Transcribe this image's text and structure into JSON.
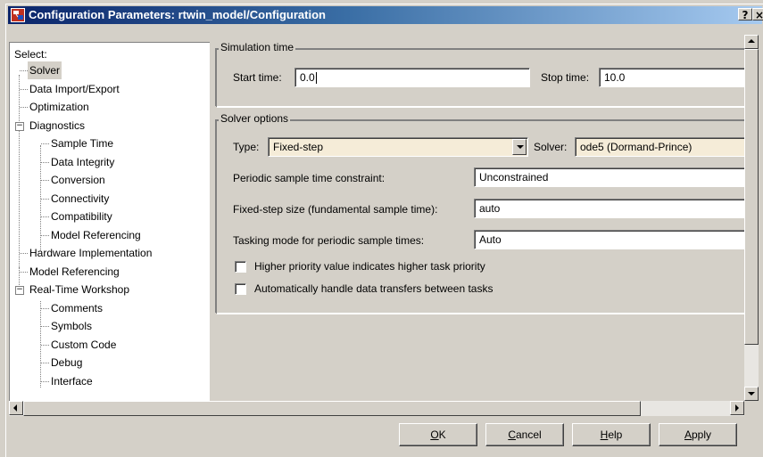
{
  "window": {
    "title": "Configuration Parameters: rtwin_model/Configuration",
    "help_button": "?",
    "close_button": "×"
  },
  "tree": {
    "select_label": "Select:",
    "items": [
      {
        "label": "Solver",
        "selected": true
      },
      {
        "label": "Data Import/Export"
      },
      {
        "label": "Optimization"
      },
      {
        "label": "Diagnostics",
        "expanded": true
      },
      {
        "label": "Sample Time"
      },
      {
        "label": "Data Integrity"
      },
      {
        "label": "Conversion"
      },
      {
        "label": "Connectivity"
      },
      {
        "label": "Compatibility"
      },
      {
        "label": "Model Referencing"
      },
      {
        "label": "Hardware Implementation"
      },
      {
        "label": "Model Referencing"
      },
      {
        "label": "Real-Time Workshop",
        "expanded": true
      },
      {
        "label": "Comments"
      },
      {
        "label": "Symbols"
      },
      {
        "label": "Custom Code"
      },
      {
        "label": "Debug"
      },
      {
        "label": "Interface"
      }
    ]
  },
  "simulation_time": {
    "legend": "Simulation time",
    "start_label": "Start time:",
    "start_value": "0.0",
    "stop_label": "Stop time:",
    "stop_value": "10.0"
  },
  "solver_options": {
    "legend": "Solver options",
    "type_label": "Type:",
    "type_value": "Fixed-step",
    "solver_label": "Solver:",
    "solver_value": "ode5 (Dormand-Prince)",
    "periodic_label": "Periodic sample time constraint:",
    "periodic_value": "Unconstrained",
    "step_label": "Fixed-step size (fundamental sample time):",
    "step_value": "auto",
    "tasking_label": "Tasking mode for periodic sample times:",
    "tasking_value": "Auto",
    "check1_label": "Higher priority value indicates higher task priority",
    "check1_checked": false,
    "check2_label": "Automatically handle data transfers between tasks",
    "check2_checked": false
  },
  "buttons": {
    "ok_mnemonic": "O",
    "ok_rest": "K",
    "cancel_mnemonic": "C",
    "cancel_rest": "ancel",
    "help_mnemonic": "H",
    "help_rest": "elp",
    "apply_mnemonic": "A",
    "apply_rest": "pply"
  },
  "colors": {
    "title_gradient_start": "#0a246a",
    "title_gradient_end": "#a6caf0",
    "face": "#d4d0c8",
    "readonly_field": "#f5ecd8"
  }
}
